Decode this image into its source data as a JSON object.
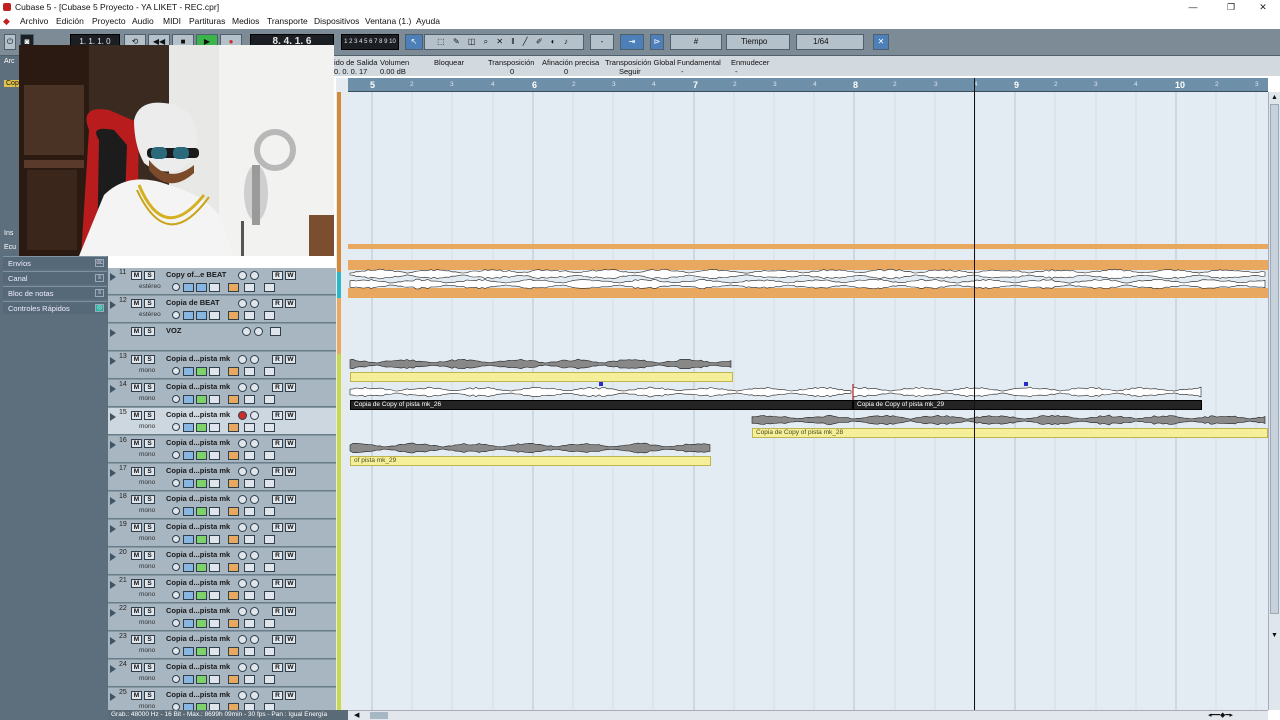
{
  "app": {
    "title": "Cubase 5 - [Cubase 5 Proyecto - YA LIKET - REC.cpr]",
    "window_controls": [
      "—",
      "❐",
      "✕"
    ]
  },
  "menu": [
    "Archivo",
    "Edición",
    "Proyecto",
    "Audio",
    "MIDI",
    "Partituras",
    "Medios",
    "Transporte",
    "Dispositivos",
    "Ventana (1.)",
    "Ayuda"
  ],
  "toolbar": {
    "position_left": "1. 1. 1.  0",
    "position_right": "8. 4. 1.  6",
    "keypad": "1 2 3 4 5 6 7 8 9 10",
    "snap_type": "Tiempo",
    "quantize": "1/64",
    "grid_dash": "-"
  },
  "infoline": {
    "labels": [
      "ido de Salida",
      "Volumen",
      "Bloquear",
      "Transposición",
      "Afinación precisa",
      "Transposición Global",
      "Fundamental",
      "Enmudecer"
    ],
    "values": [
      "0. 0. 0. 17",
      "0.00 dB",
      "",
      "0",
      "0",
      "Seguir",
      "-",
      "-"
    ]
  },
  "ruler": {
    "major": [
      "5",
      "6",
      "7",
      "8",
      "9",
      "10"
    ],
    "minor": [
      "2",
      "3",
      "4"
    ]
  },
  "inspector": {
    "partial": [
      "Arc",
      "Cop",
      "Ins",
      "Ecu"
    ],
    "sections": [
      {
        "label": "Envíos",
        "icon": "dc"
      },
      {
        "label": "Canal",
        "icon": "≡"
      },
      {
        "label": "Bloc de notas",
        "icon": "≡"
      },
      {
        "label": "Controles Rápidos",
        "icon": "◎"
      }
    ]
  },
  "tracks": [
    {
      "num": "11",
      "name": "Copy of...e BEAT",
      "sub": "estéreo",
      "selected": false,
      "recording": false
    },
    {
      "num": "12",
      "name": "Copia de BEAT",
      "sub": "estéreo",
      "selected": false,
      "recording": false
    },
    {
      "num": "",
      "name": "VOZ",
      "sub": "",
      "selected": false,
      "recording": false,
      "folder": true
    },
    {
      "num": "13",
      "name": "Copia d...pista mk",
      "sub": "mono",
      "selected": false,
      "recording": false
    },
    {
      "num": "14",
      "name": "Copia d...pista mk",
      "sub": "mono",
      "selected": false,
      "recording": false
    },
    {
      "num": "15",
      "name": "Copia d...pista mk",
      "sub": "mono",
      "selected": true,
      "recording": true
    },
    {
      "num": "16",
      "name": "Copia d...pista mk",
      "sub": "mono",
      "selected": false,
      "recording": false
    },
    {
      "num": "17",
      "name": "Copia d...pista mk",
      "sub": "mono",
      "selected": false,
      "recording": false
    },
    {
      "num": "18",
      "name": "Copia d...pista mk",
      "sub": "mono",
      "selected": false,
      "recording": false
    },
    {
      "num": "19",
      "name": "Copia d...pista mk",
      "sub": "mono",
      "selected": false,
      "recording": false
    },
    {
      "num": "20",
      "name": "Copia d...pista mk",
      "sub": "mono",
      "selected": false,
      "recording": false
    },
    {
      "num": "21",
      "name": "Copia d...pista mk",
      "sub": "mono",
      "selected": false,
      "recording": false
    },
    {
      "num": "22",
      "name": "Copia d...pista mk",
      "sub": "mono",
      "selected": false,
      "recording": false
    },
    {
      "num": "23",
      "name": "Copia d...pista mk",
      "sub": "mono",
      "selected": false,
      "recording": false
    },
    {
      "num": "24",
      "name": "Copia d...pista mk",
      "sub": "mono",
      "selected": false,
      "recording": false
    },
    {
      "num": "25",
      "name": "Copia d...pista mk",
      "sub": "mono",
      "selected": false,
      "recording": false
    }
  ],
  "events": {
    "ev14a": "Copia de Copy of pista mk_26",
    "ev14b": "Copia de Copy of pista mk_29",
    "ev15": "Copia de Copy of pista mk_28",
    "ev16": "of pista mk_29"
  },
  "status": "Grab.: 48000 Hz - 16 Bit - Max.: 8699h 09min - 30 fps - Pan : Igual Energía"
}
